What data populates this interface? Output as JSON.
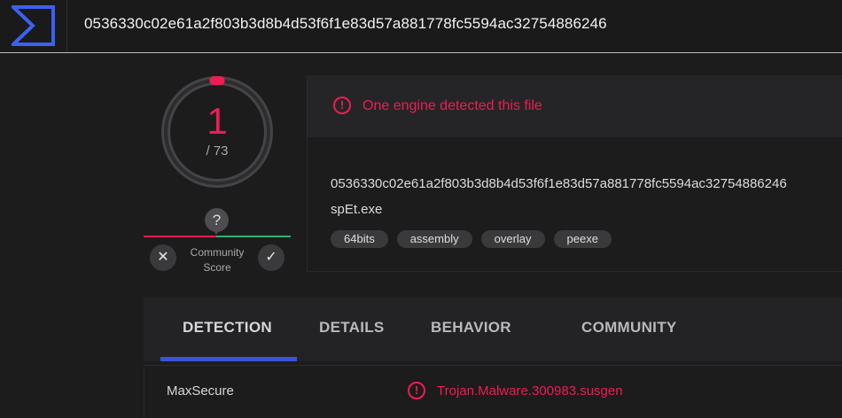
{
  "header": {
    "logo": "virustotal-sigma-logo",
    "title": "0536330c02e61a2f803b3d8b4d53f6f1e83d57a881778fc5594ac32754886246"
  },
  "score": {
    "detections": "1",
    "total": "/ 73",
    "detection_fraction": 0.0137,
    "community_question": "?",
    "community_label_line1": "Community",
    "community_label_line2": "Score",
    "vote_down_icon": "close-icon",
    "vote_up_icon": "check-icon"
  },
  "summary": {
    "alert_text": "One engine detected this file",
    "file_hash": "0536330c02e61a2f803b3d8b4d53f6f1e83d57a881778fc5594ac32754886246",
    "file_name": "spEt.exe",
    "tags": [
      "64bits",
      "assembly",
      "overlay",
      "peexe"
    ]
  },
  "tabs": [
    {
      "label": "DETECTION",
      "active": true
    },
    {
      "label": "DETAILS",
      "active": false
    },
    {
      "label": "BEHAVIOR",
      "active": false
    },
    {
      "label": "COMMUNITY",
      "active": false
    }
  ],
  "detections": [
    {
      "engine": "MaxSecure",
      "result": "Trojan.Malware.300983.susgen"
    }
  ],
  "colors": {
    "malicious": "#ee1d52",
    "accent": "#3b53d9",
    "clean": "#2fb36b"
  }
}
